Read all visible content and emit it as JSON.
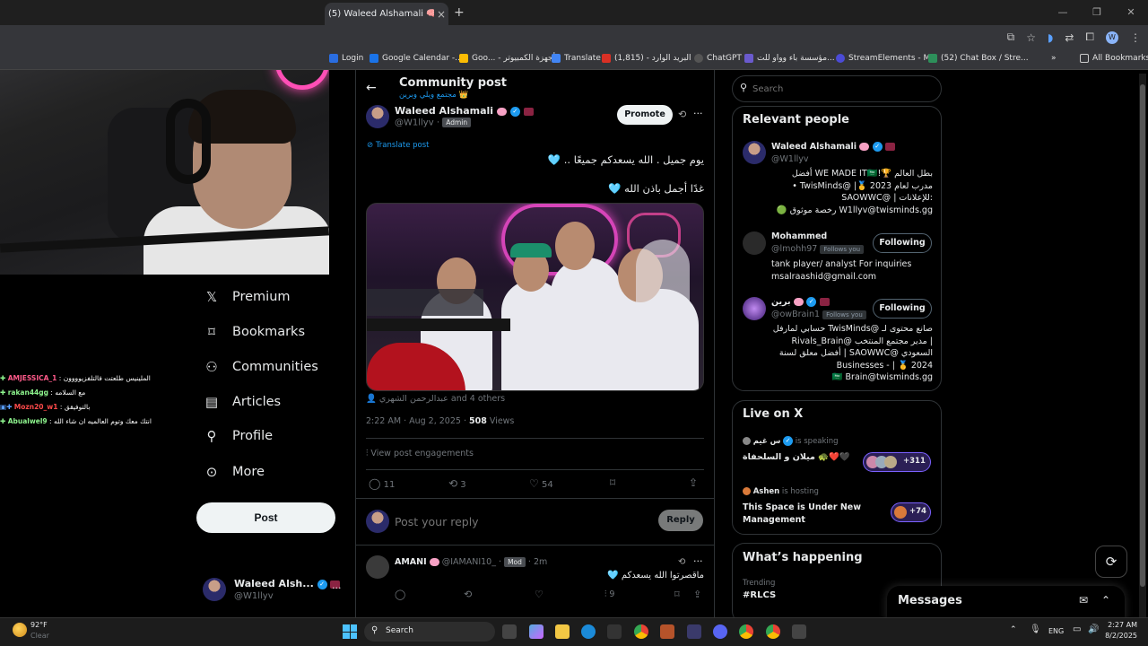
{
  "browser": {
    "tab_title": "(5) Waleed Alshamali 🧠 on X:",
    "tab_close": "×",
    "new_tab": "+",
    "window_buttons": [
      "—",
      "❐",
      "✕"
    ],
    "bookmarks": [
      {
        "label": "Login",
        "icon_color": "#2a6de0"
      },
      {
        "label": "Google Calendar -...",
        "icon_color": "#1a73e8"
      },
      {
        "label": "Goo... - أجهزة الكمبيوتر",
        "icon_color": "#fbbc04"
      },
      {
        "label": "Translate",
        "icon_color": "#4285f4"
      },
      {
        "label": "البريد الوارد - (1,815)",
        "icon_color": "#d93025"
      },
      {
        "label": "ChatGPT",
        "icon_color": "#555555"
      },
      {
        "label": "مؤسسة باء وواو للت...",
        "icon_color": "#6a5acd"
      },
      {
        "label": "StreamElements - M...",
        "icon_color": "#4b4bd6"
      },
      {
        "label": "(52) Chat Box / Stre...",
        "icon_color": "#2d8f5a"
      }
    ],
    "bookmarks_overflow": "»",
    "all_bookmarks": "All Bookmarks",
    "profile_initial": "W"
  },
  "stream_chat": {
    "header": "",
    "messages": [
      {
        "user": "AMJESSICA_1",
        "text": "الملينيس طلعتت فالتلفزيوووون",
        "color": "#ff5a8a"
      },
      {
        "user": "rakan44gg",
        "text": "مع السلامه",
        "color": "#8ef58e"
      },
      {
        "user": "Mozn20_w1",
        "text": "بالتوفيقق",
        "color": "#ff4a4a"
      },
      {
        "user": "Abualwel9",
        "text": "انتك معك وتوم العالميه ان شاء الله",
        "color": "#8ef58e"
      }
    ]
  },
  "nav": {
    "items": [
      {
        "label": "Premium",
        "icon": "x-logo-icon",
        "glyph": "𝕏"
      },
      {
        "label": "Bookmarks",
        "icon": "bookmark-icon",
        "glyph": "🔖"
      },
      {
        "label": "Communities",
        "icon": "communities-icon",
        "glyph": "👥"
      },
      {
        "label": "Articles",
        "icon": "articles-icon",
        "glyph": "📝"
      },
      {
        "label": "Profile",
        "icon": "profile-icon",
        "glyph": "👤"
      },
      {
        "label": "More",
        "icon": "more-icon",
        "glyph": "⋯"
      }
    ],
    "post_label": "Post",
    "account_name": "Waleed Alsh...",
    "account_handle": "@W1llyv",
    "account_more": "···"
  },
  "post": {
    "header_title": "Community post",
    "header_sub": "مجتمع ويلي وبرين 👑",
    "back": "←",
    "author_name": "Waleed Alshamali",
    "author_handle": "@W1llyv",
    "author_role": "Admin",
    "promote": "Promote",
    "more": "···",
    "translate": "Translate post",
    "line1": "يوم جميل . الله يسعدكم جميعًا .. 🩵",
    "line2": "غدًا أجمل باذن الله 🩵",
    "tagged": "عبدالرحمن الشهري and 4 others",
    "time": "2:22 AM · Aug 2, 2025 ·",
    "views_count": "508",
    "views_label": "Views",
    "engagements": "View post engagements",
    "replies": "11",
    "reposts": "3",
    "likes": "54",
    "reply_placeholder": "Post your reply",
    "reply_button": "Reply"
  },
  "reply": {
    "author": "AMANI",
    "handle": "@IAMANI10_",
    "role": "Mod",
    "age": "· 2m",
    "text": "ماقصرتوا الله يسعدكم 🩵",
    "views": "9"
  },
  "search": {
    "placeholder": "Search"
  },
  "relevant": {
    "title": "Relevant people",
    "people": [
      {
        "name": "Waleed Alshamali",
        "handle": "@W1llyv",
        "follows_you": "",
        "button": "",
        "bio": [
          "بطل العالم 🏆!WE MADE IT🇸🇦 أفضل",
          "مدرب لعام 2023 🥇| @TwisMinds •",
          ":للإعلانات | @SAOWWC",
          "W1llyv@twisminds.gg رخصة موثوق 🟢"
        ]
      },
      {
        "name": "Mohammed",
        "handle": "@lmohh97",
        "follows_you": "Follows you",
        "button": "Following",
        "bio": [
          "tank player/ analyst For inquiries",
          "msalraashid@gmail.com"
        ]
      },
      {
        "name": "برين",
        "handle": "@owBrain1",
        "follows_you": "Follows you",
        "button": "Following",
        "bio": [
          "صانع محتوى لـ @TwisMinds حسابي لمارفل",
          "| مدير مجتمع المنتخب @Rivals_Brain",
          "السعودي @SAOWWC | أفضل معلق لسنة",
          "Businesses - | 🥇 2024",
          "🇸🇦 Brain@twisminds.gg"
        ]
      }
    ]
  },
  "live": {
    "title": "Live on X",
    "spaces": [
      {
        "host": "س غيم",
        "status": "is speaking",
        "title": "ميلان و السلحفاة 🐢❤️🖤",
        "count": "+311"
      },
      {
        "host": "Ashen",
        "status": "is hosting",
        "title": "This Space is Under New Management",
        "count": "+74"
      }
    ]
  },
  "happening": {
    "title": "What’s happening",
    "category": "Trending",
    "topic": "#RLCS"
  },
  "messages": {
    "title": "Messages"
  },
  "taskbar": {
    "temp": "92°F",
    "weather": "Clear",
    "search": "Search",
    "lang": "ENG",
    "time": "2:27 AM",
    "date": "8/2/2025"
  }
}
